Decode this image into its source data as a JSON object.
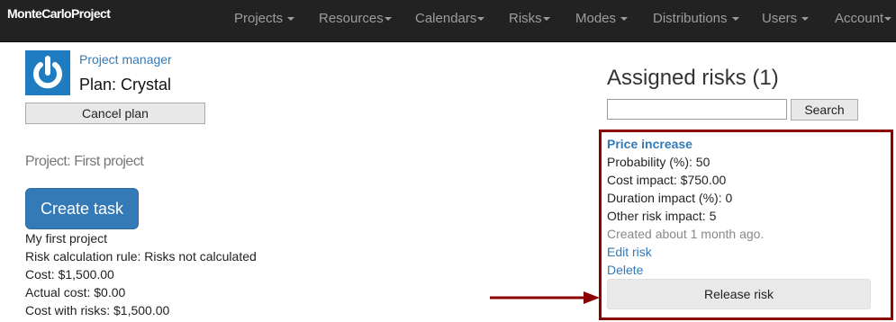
{
  "navbar": {
    "brand": "MonteCarloProject",
    "items": [
      {
        "label": "Projects"
      },
      {
        "label": "Resources"
      },
      {
        "label": "Calendars"
      },
      {
        "label": "Risks"
      },
      {
        "label": "Modes"
      },
      {
        "label": "Distributions"
      },
      {
        "label": "Users"
      },
      {
        "label": "Account"
      }
    ]
  },
  "plan": {
    "manager_link": "Project manager",
    "title": "Plan: Crystal",
    "cancel_label": "Cancel plan"
  },
  "project": {
    "title": "Project: First project",
    "create_task_label": "Create task",
    "details": [
      "My first project",
      "Risk calculation rule: Risks not calculated",
      "Cost: $1,500.00",
      "Actual cost: $0.00",
      "Cost with risks: $1,500.00"
    ]
  },
  "risks": {
    "heading": "Assigned risks (1)",
    "search_value": "",
    "search_label": "Search",
    "item": {
      "name": "Price increase",
      "probability": "Probability (%): 50",
      "cost_impact": "Cost impact: $750.00",
      "duration_impact": "Duration impact (%): 0",
      "other_impact": "Other risk impact: 5",
      "created": "Created about 1 month ago.",
      "edit_label": "Edit risk",
      "delete_label": "Delete",
      "release_label": "Release risk"
    }
  },
  "colors": {
    "navbar_bg": "#222222",
    "accent": "#337ab7",
    "highlight": "#8b0000"
  }
}
